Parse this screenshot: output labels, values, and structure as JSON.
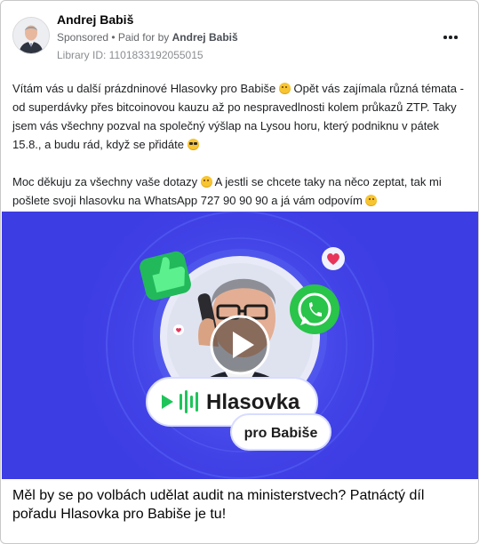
{
  "post": {
    "author": "Andrej Babiš",
    "sponsored_label": "Sponsored",
    "paid_for_prefix": "• Paid for by",
    "paid_for_name": "Andrej Babiš",
    "library_id": "Library ID: 1101833192055015",
    "more_icon": "ellipsis-horizontal-icon"
  },
  "message": {
    "paragraph1_a": "Vítám vás u další prázdninové Hlasovky pro Babiše ",
    "paragraph1_b": " Opět vás zajímala různá témata - od superdávky přes bitcoinovou kauzu až po nespravedlnosti kolem průkazů ZTP. Taky jsem vás všechny pozval na společný výšlap na Lysou horu, který podniknu v pátek 15.8., a budu rád, když se přidáte ",
    "paragraph2_a": "Moc děkuju za všechny vaše dotazy ",
    "paragraph2_b": " A jestli se chcete taky na něco zeptat, tak mi pošlete svoji hlasovku na WhatsApp 727 90 90 90 a já vám odpovím "
  },
  "media": {
    "badge_title": "Hlasovka",
    "badge_subtitle": "pro Babiše",
    "play_icon": "play-icon",
    "thumbs_up_icon": "thumbs-up-icon",
    "whatsapp_icon": "whatsapp-icon",
    "heart_icon": "heart-icon",
    "colors": {
      "background": "#3f3fe6",
      "thumbs": "#2fcf6b",
      "whatsapp": "#29c44a",
      "heart": "#e8345a",
      "badge_play": "#1ec45a"
    }
  },
  "caption": "Měl by se po volbách udělat audit na ministerstvech? Patnáctý díl pořadu Hlasovka pro Babiše je tu!"
}
